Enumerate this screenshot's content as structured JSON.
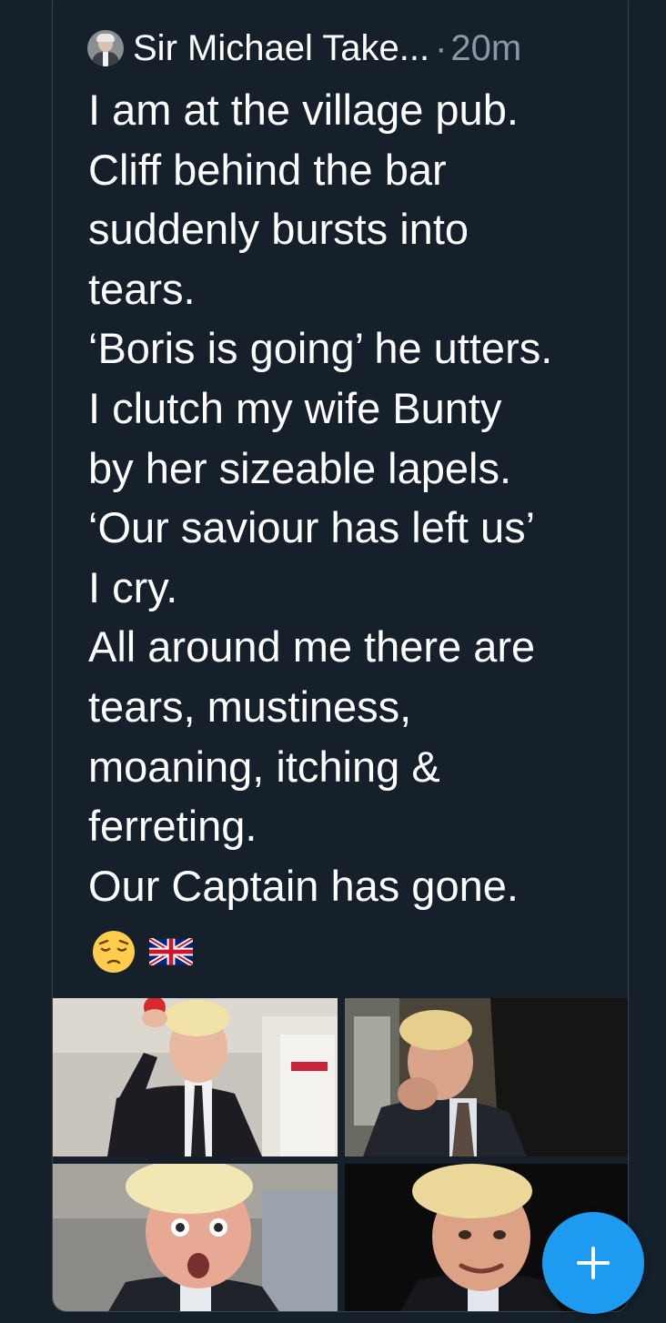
{
  "tweet": {
    "author_name": "Sir Michael Take...",
    "separator": "·",
    "timestamp": "20m",
    "text": "I am at the village pub.\nCliff behind the bar\nsuddenly bursts into\ntears.\n‘Boris is going’ he utters.\nI clutch my wife Bunty\nby her sizeable lapels.\n‘Our saviour has left us’\nI cry.\nAll around me there are\ntears, mustiness,\nmoaning, itching &\nferreting.\nOur Captain has gone.",
    "emojis": [
      "pensive-face-emoji",
      "uk-flag-emoji"
    ]
  },
  "media": {
    "photo_count": 4
  },
  "compose_button": {
    "icon": "plus-icon"
  },
  "colors": {
    "background": "#15202b",
    "border": "#38444d",
    "text": "#ffffff",
    "muted": "#8899a6",
    "accent": "#1d9bf0"
  }
}
